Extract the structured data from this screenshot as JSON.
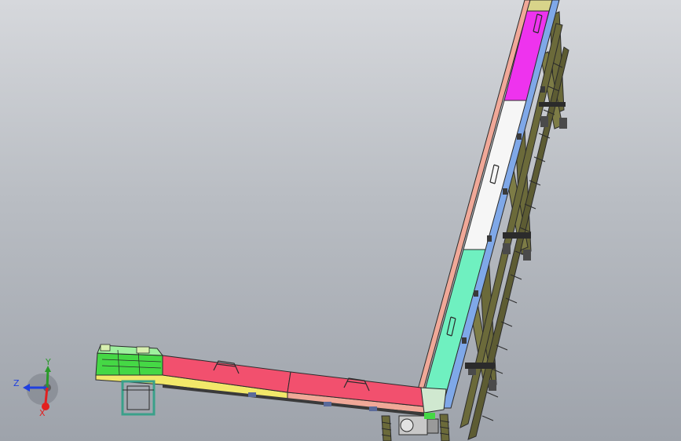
{
  "viewport": {
    "background_top": "#d6d8dc",
    "background_bottom": "#9ea3ab"
  },
  "model": {
    "colors": {
      "frame_outline": "#2b2b2b",
      "support_legs": "#6b6a3a",
      "leg_pads": "#4a4a4a",
      "side_rail_blue": "#7fa8e8",
      "side_rail_salmon": "#f0a898",
      "side_rail_yellow": "#f2e86a",
      "segment_magenta": "#ee33ee",
      "segment_white": "#f6f6f6",
      "segment_aqua": "#6ff0c0",
      "segment_red": "#f2506e",
      "segment_green": "#45d845",
      "tail_frame_teal": "#3aa08a",
      "motor_grey": "#c8c8c8"
    }
  },
  "triad": {
    "x_label": "X",
    "y_label": "Y",
    "z_label": "Z",
    "x_color": "#e22020",
    "y_color": "#2a9a2a",
    "z_color": "#2040e0"
  }
}
